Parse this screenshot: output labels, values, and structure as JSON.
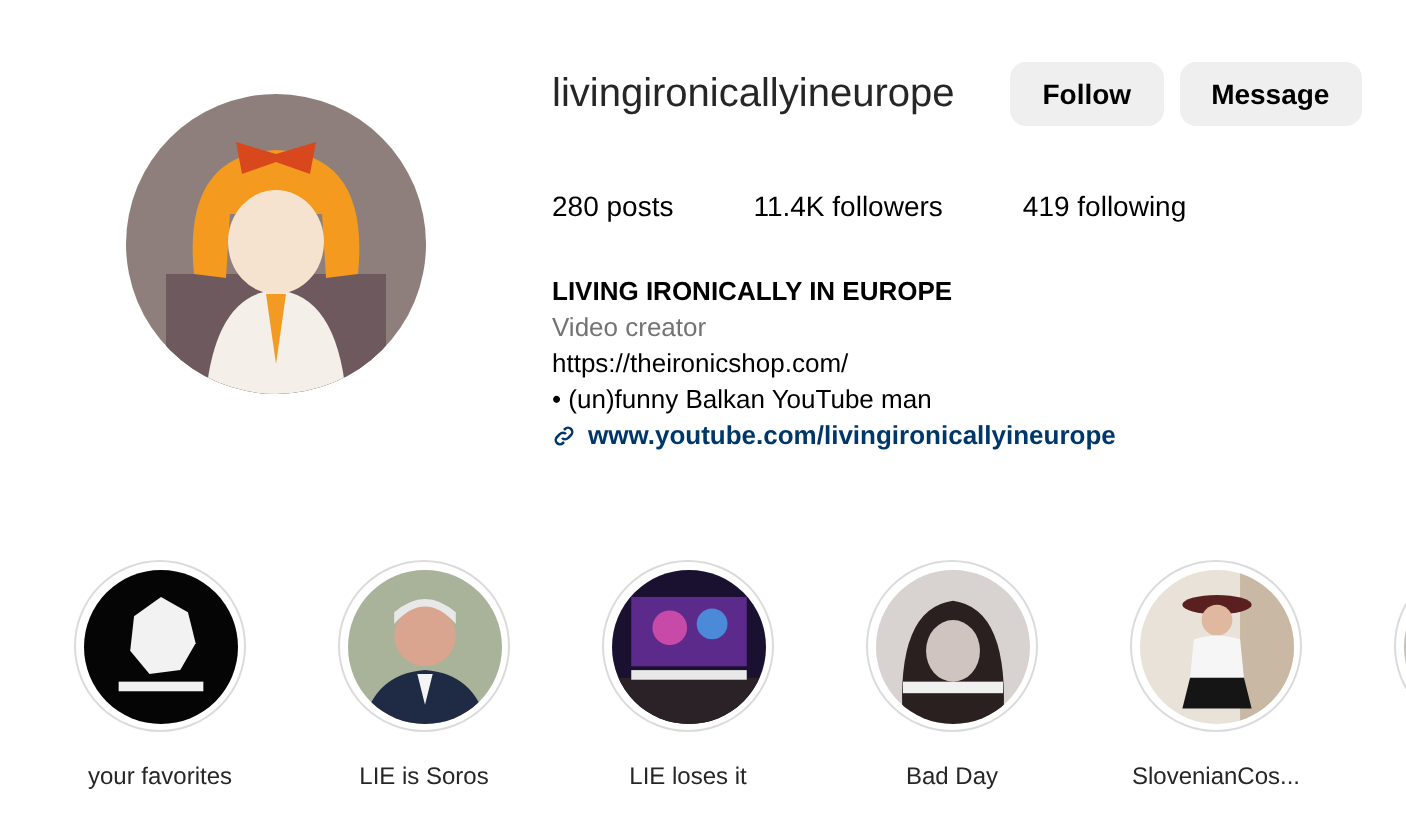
{
  "profile": {
    "username": "livingironicallyineurope",
    "buttons": [
      "Follow",
      "Message"
    ],
    "stats": [
      "280 posts",
      "11.4K followers",
      "419 following"
    ],
    "name": "LIVING IRONICALLY IN EUROPE",
    "category": "Video creator",
    "bio_lines": [
      "https://theironicshop.com/",
      "• (un)funny Balkan YouTube man"
    ],
    "link": "www.youtube.com/livingironicallyineurope"
  },
  "highlights": [
    {
      "label": "your favorites",
      "kind": "picture"
    },
    {
      "label": "LIE is Soros",
      "kind": "picture"
    },
    {
      "label": "LIE loses it",
      "kind": "picture"
    },
    {
      "label": "Bad Day",
      "kind": "picture"
    },
    {
      "label": "SlovenianCos...",
      "kind": "picture"
    },
    {
      "kind": "picture"
    }
  ]
}
